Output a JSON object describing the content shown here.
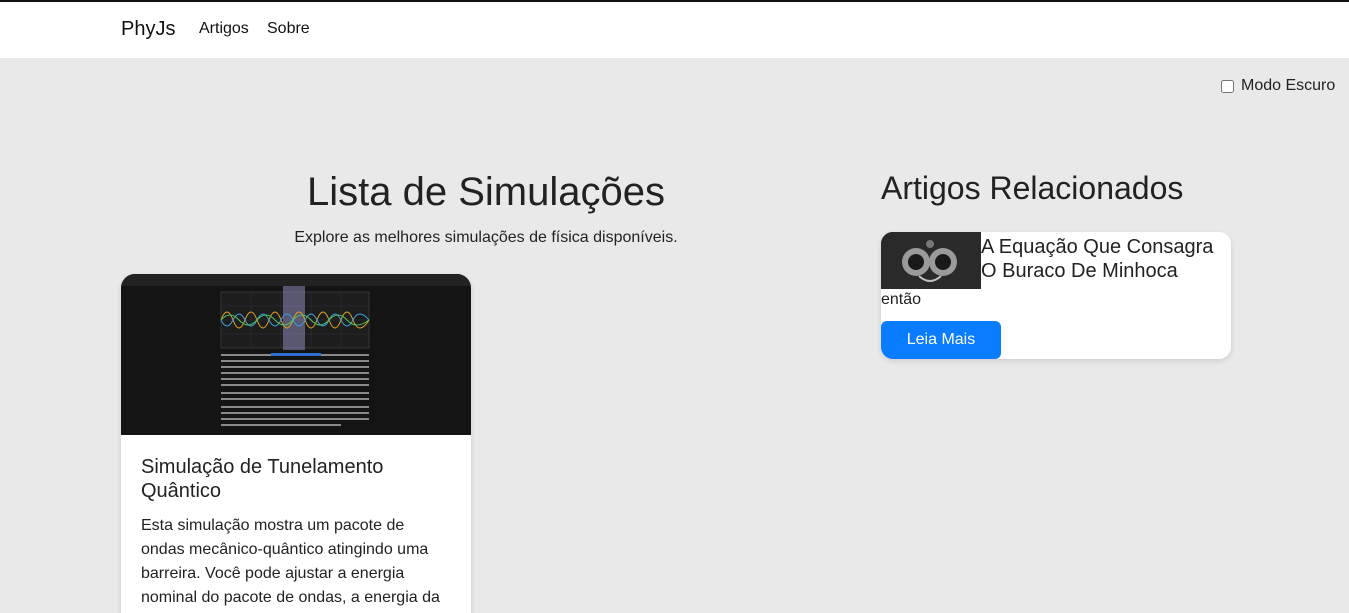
{
  "navbar": {
    "brand": "PhyJs",
    "links": [
      "Artigos",
      "Sobre"
    ]
  },
  "dark_mode": {
    "label": "Modo Escuro",
    "checked": false
  },
  "simulations": {
    "title": "Lista de Simulações",
    "subtitle": "Explore as melhores simulações de física disponíveis.",
    "cards": [
      {
        "title": "Simulação de Tunelamento Quântico",
        "description": "Esta simulação mostra um pacote de ondas mecânico-quântico atingindo uma barreira. Você pode ajustar a energia nominal do pacote de ondas, a energia da"
      }
    ]
  },
  "related": {
    "title": "Artigos Relacionados",
    "articles": [
      {
        "title": "A Equação Que Consagra O Buraco De Minhoca",
        "excerpt": "então",
        "button": "Leia Mais"
      }
    ]
  },
  "colors": {
    "background": "#e9e9e9",
    "navbar": "#ffffff",
    "accent": "#0a7cff",
    "thumbnail_bg": "#141414"
  }
}
